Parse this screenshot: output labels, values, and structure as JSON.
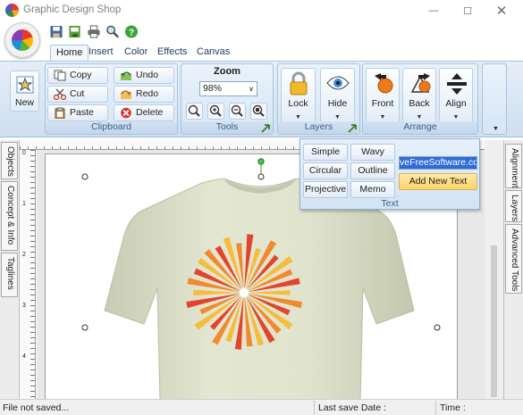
{
  "window": {
    "title": "Graphic Design Shop",
    "minimize_glyph": "—",
    "maximize_glyph": "☐",
    "close_glyph": "✕"
  },
  "quick_access": [
    "save-icon",
    "save-all-icon",
    "print-icon",
    "print-preview-icon",
    "help-icon"
  ],
  "tabs": [
    {
      "label": "Home",
      "active": true
    },
    {
      "label": "Insert"
    },
    {
      "label": "Color"
    },
    {
      "label": "Effects"
    },
    {
      "label": "Canvas"
    }
  ],
  "ribbon": {
    "new_label": "New",
    "clipboard": {
      "copy": "Copy",
      "cut": "Cut",
      "paste": "Paste",
      "undo": "Undo",
      "redo": "Redo",
      "delete": "Delete",
      "label": "Clipboard"
    },
    "tools": {
      "zoom_title": "Zoom",
      "zoom_value": "98%",
      "label": "Tools"
    },
    "layers": {
      "lock": "Lock",
      "hide": "Hide",
      "label": "Layers"
    },
    "arrange": {
      "front": "Front",
      "back": "Back",
      "align": "Align",
      "label": "Arrange"
    }
  },
  "text_panel": {
    "simple": "Simple",
    "wavy": "Wavy",
    "circular": "Circular",
    "outline": "Outline",
    "projective": "Projective",
    "memo": "Memo",
    "input_value": "veFreeSoftware.com",
    "add_button": "Add New Text",
    "label": "Text"
  },
  "left_tabs": [
    "Objects",
    "Concept & Info",
    "Taglines"
  ],
  "right_tabs": [
    "Alignment",
    "Layers",
    "Advanced Tools"
  ],
  "ruler_marks": [
    "0",
    "1",
    "2",
    "3",
    "4"
  ],
  "status": {
    "saved": "File not saved...",
    "last_save": "Last save Date :",
    "time": "Time :"
  },
  "colors": {
    "shirt": "#dcdfc8",
    "ray_orange": "#f08a2c",
    "ray_red": "#e2452b",
    "ray_yellow": "#f6bd3c",
    "accent": "#2e6bd8"
  }
}
